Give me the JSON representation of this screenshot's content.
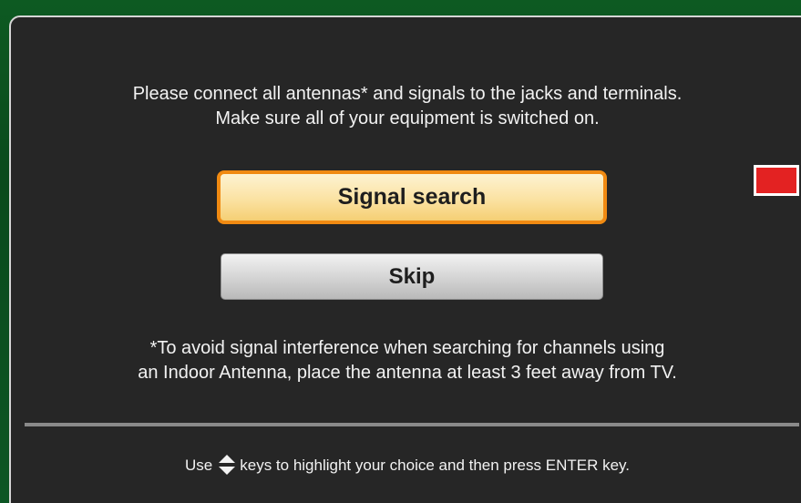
{
  "dialog": {
    "intro_line1": "Please connect all antennas* and signals to the jacks and terminals.",
    "intro_line2": "Make sure all of your equipment is switched on.",
    "buttons": {
      "signal_search": "Signal search",
      "skip": "Skip"
    },
    "note_line1": "*To avoid signal interference when searching for channels using",
    "note_line2": "an Indoor Antenna, place the antenna at least 3 feet away from TV.",
    "footer_prefix": "Use",
    "footer_icon": "up-down-arrows-icon",
    "footer_suffix": "keys to highlight your choice and then press ENTER key."
  },
  "colors": {
    "background": "#0a4a1c",
    "panel": "#262626",
    "panel_border": "#d6d6d6",
    "highlight_border": "#f08a12",
    "indicator": "#e32222"
  }
}
